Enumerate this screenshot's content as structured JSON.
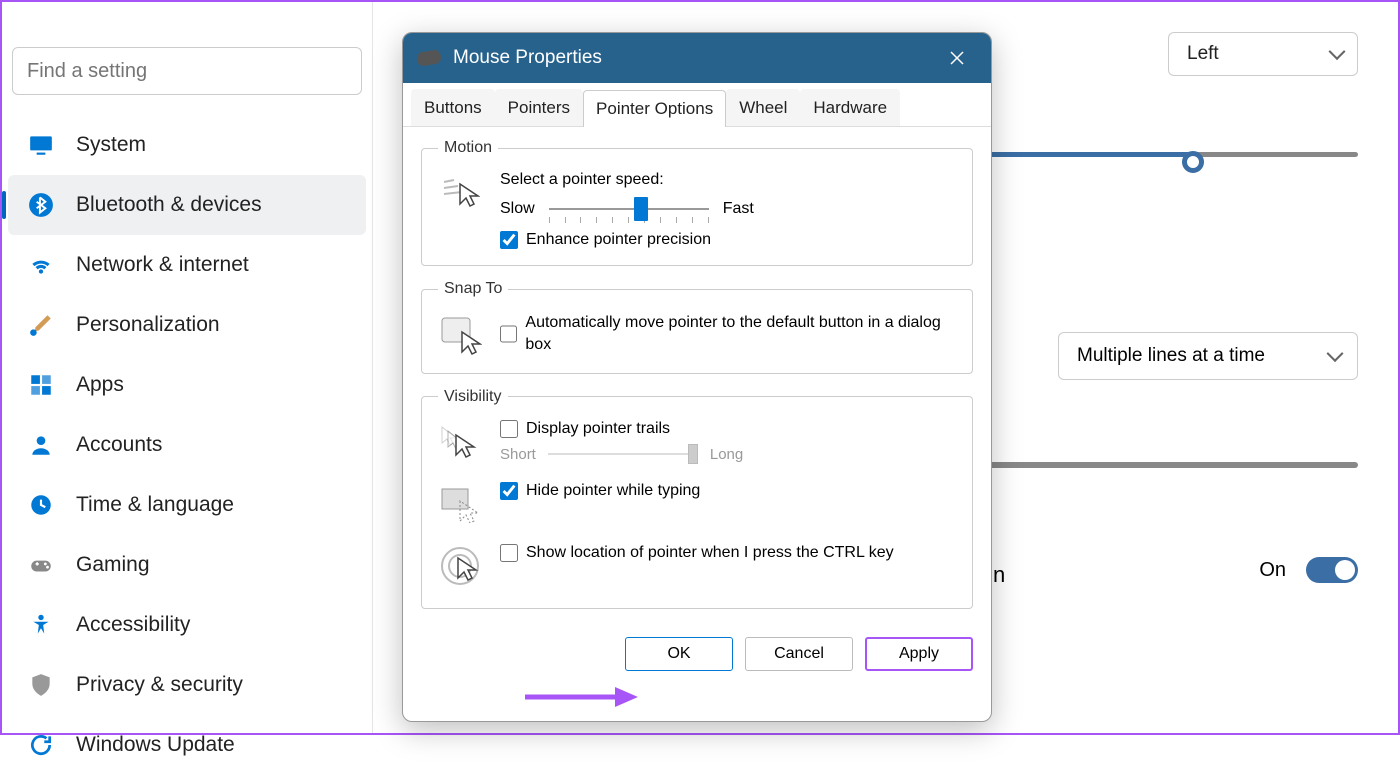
{
  "search": {
    "placeholder": "Find a setting"
  },
  "nav": [
    {
      "label": "System",
      "icon": "monitor",
      "active": false
    },
    {
      "label": "Bluetooth & devices",
      "icon": "bluetooth",
      "active": true
    },
    {
      "label": "Network & internet",
      "icon": "wifi",
      "active": false
    },
    {
      "label": "Personalization",
      "icon": "brush",
      "active": false
    },
    {
      "label": "Apps",
      "icon": "apps",
      "active": false
    },
    {
      "label": "Accounts",
      "icon": "person",
      "active": false
    },
    {
      "label": "Time & language",
      "icon": "clock",
      "active": false
    },
    {
      "label": "Gaming",
      "icon": "gamepad",
      "active": false
    },
    {
      "label": "Accessibility",
      "icon": "accessibility",
      "active": false
    },
    {
      "label": "Privacy & security",
      "icon": "shield",
      "active": false
    },
    {
      "label": "Windows Update",
      "icon": "update",
      "active": false
    }
  ],
  "right": {
    "primary_dropdown": "Left",
    "scroll_dropdown": "Multiple lines at a time",
    "toggle_label": "On",
    "partial_text": "n"
  },
  "dialog": {
    "title": "Mouse Properties",
    "tabs": [
      "Buttons",
      "Pointers",
      "Pointer Options",
      "Wheel",
      "Hardware"
    ],
    "active_tab": "Pointer Options",
    "motion": {
      "legend": "Motion",
      "select_label": "Select a pointer speed:",
      "slow": "Slow",
      "fast": "Fast",
      "enhance": "Enhance pointer precision",
      "enhance_checked": true
    },
    "snap": {
      "legend": "Snap To",
      "text": "Automatically move pointer to the default button in a dialog box",
      "checked": false
    },
    "visibility": {
      "legend": "Visibility",
      "trails": "Display pointer trails",
      "trails_checked": false,
      "short": "Short",
      "long": "Long",
      "hide_typing": "Hide pointer while typing",
      "hide_typing_checked": true,
      "ctrl_location": "Show location of pointer when I press the CTRL key",
      "ctrl_checked": false
    },
    "buttons": {
      "ok": "OK",
      "cancel": "Cancel",
      "apply": "Apply"
    }
  }
}
